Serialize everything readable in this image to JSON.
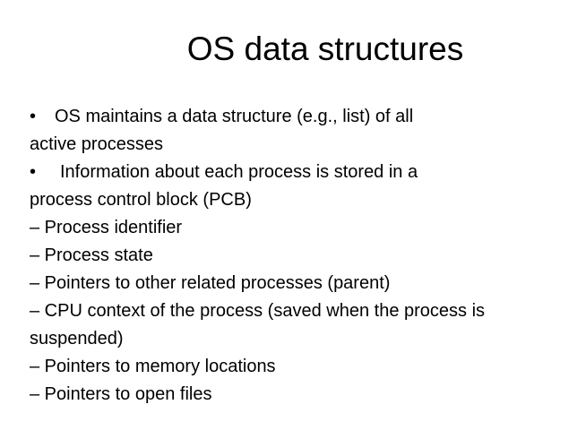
{
  "slide": {
    "title": "OS data structures",
    "bullet_glyph": "•",
    "lines": [
      "OS maintains a data structure (e.g., list) of all",
      "active processes",
      "Information about each process is stored in a",
      "process control block (PCB)",
      "– Process identifier",
      "– Process state",
      "– Pointers to other related processes (parent)",
      "– CPU context of the process (saved when the process is",
      "suspended)",
      "– Pointers to memory locations",
      "– Pointers to open files"
    ]
  }
}
